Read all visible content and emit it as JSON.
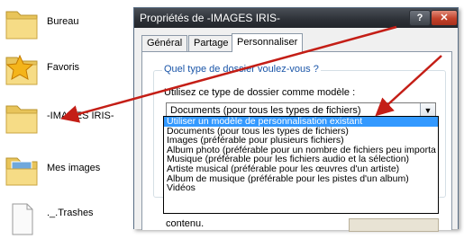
{
  "explorer": {
    "items": [
      {
        "label": "Bureau",
        "icon": "folder-icon"
      },
      {
        "label": "Favoris",
        "icon": "favorites-star-folder-icon"
      },
      {
        "label": "-IMAGES IRIS-",
        "icon": "folder-icon"
      },
      {
        "label": "Mes images",
        "icon": "pictures-folder-icon"
      },
      {
        "label": "._.Trashes",
        "icon": "document-icon"
      }
    ]
  },
  "dialog": {
    "title": "Propriétés de -IMAGES IRIS-",
    "help_button": "?",
    "close_button": "✕",
    "tabs": [
      {
        "label": "Général"
      },
      {
        "label": "Partage"
      },
      {
        "label": "Personnaliser"
      }
    ],
    "active_tab": "Personnaliser",
    "group_title": "Quel type de dossier voulez-vous ?",
    "instruction": "Utilisez ce type de dossier comme modèle :",
    "combo_value": "Documents (pour tous les types de fichiers)",
    "combo_arrow": "▼",
    "dropdown_options": [
      "Utiliser un modèle de personnalisation existant",
      "Documents (pour tous les types de fichiers)",
      "Images (préférable pour plusieurs fichiers)",
      "Album photo (préférable pour un nombre de fichiers peu importa",
      "Musique (préférable pour les fichiers audio et la sélection)",
      "Artiste musical (préférable pour les œuvres d'un artiste)",
      "Album de musique (préférable pour les pistes d'un album)",
      "Vidéos"
    ],
    "selected_option": "Utiliser un modèle de personnalisation existant",
    "below_text": "contenu."
  },
  "colors": {
    "annotation_arrow": "#c41e16",
    "selection": "#3399ff",
    "group_title": "#1a55a8"
  }
}
